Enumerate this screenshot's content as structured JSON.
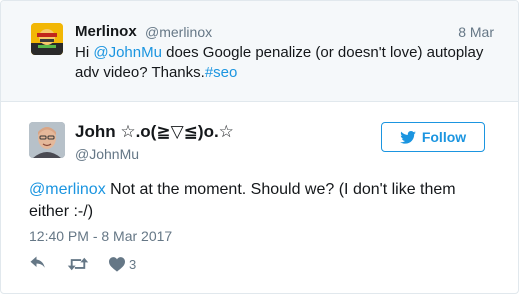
{
  "parent_tweet": {
    "name": "Merlinox",
    "handle": "@merlinox",
    "date": "8 Mar",
    "text_prefix": "Hi ",
    "mention": "@JohnMu",
    "text_middle": " does Google penalize (or doesn't love) autoplay adv video? Thanks.",
    "hashtag": "#seo",
    "avatar_icon": "merlinox-avatar"
  },
  "main_tweet": {
    "name": "John ☆.o(≧▽≦)o.☆",
    "handle": "@JohnMu",
    "follow_label": "Follow",
    "mention": "@merlinox",
    "text": " Not at the moment. Should we? (I don't like them either :-/)",
    "timestamp": "12:40 PM - 8 Mar 2017",
    "like_count": "3",
    "avatar_icon": "john-avatar"
  },
  "colors": {
    "link": "#1b95e0",
    "secondary_text": "#657786",
    "border": "#e1e8ed",
    "parent_bg": "#f5f8fa"
  }
}
